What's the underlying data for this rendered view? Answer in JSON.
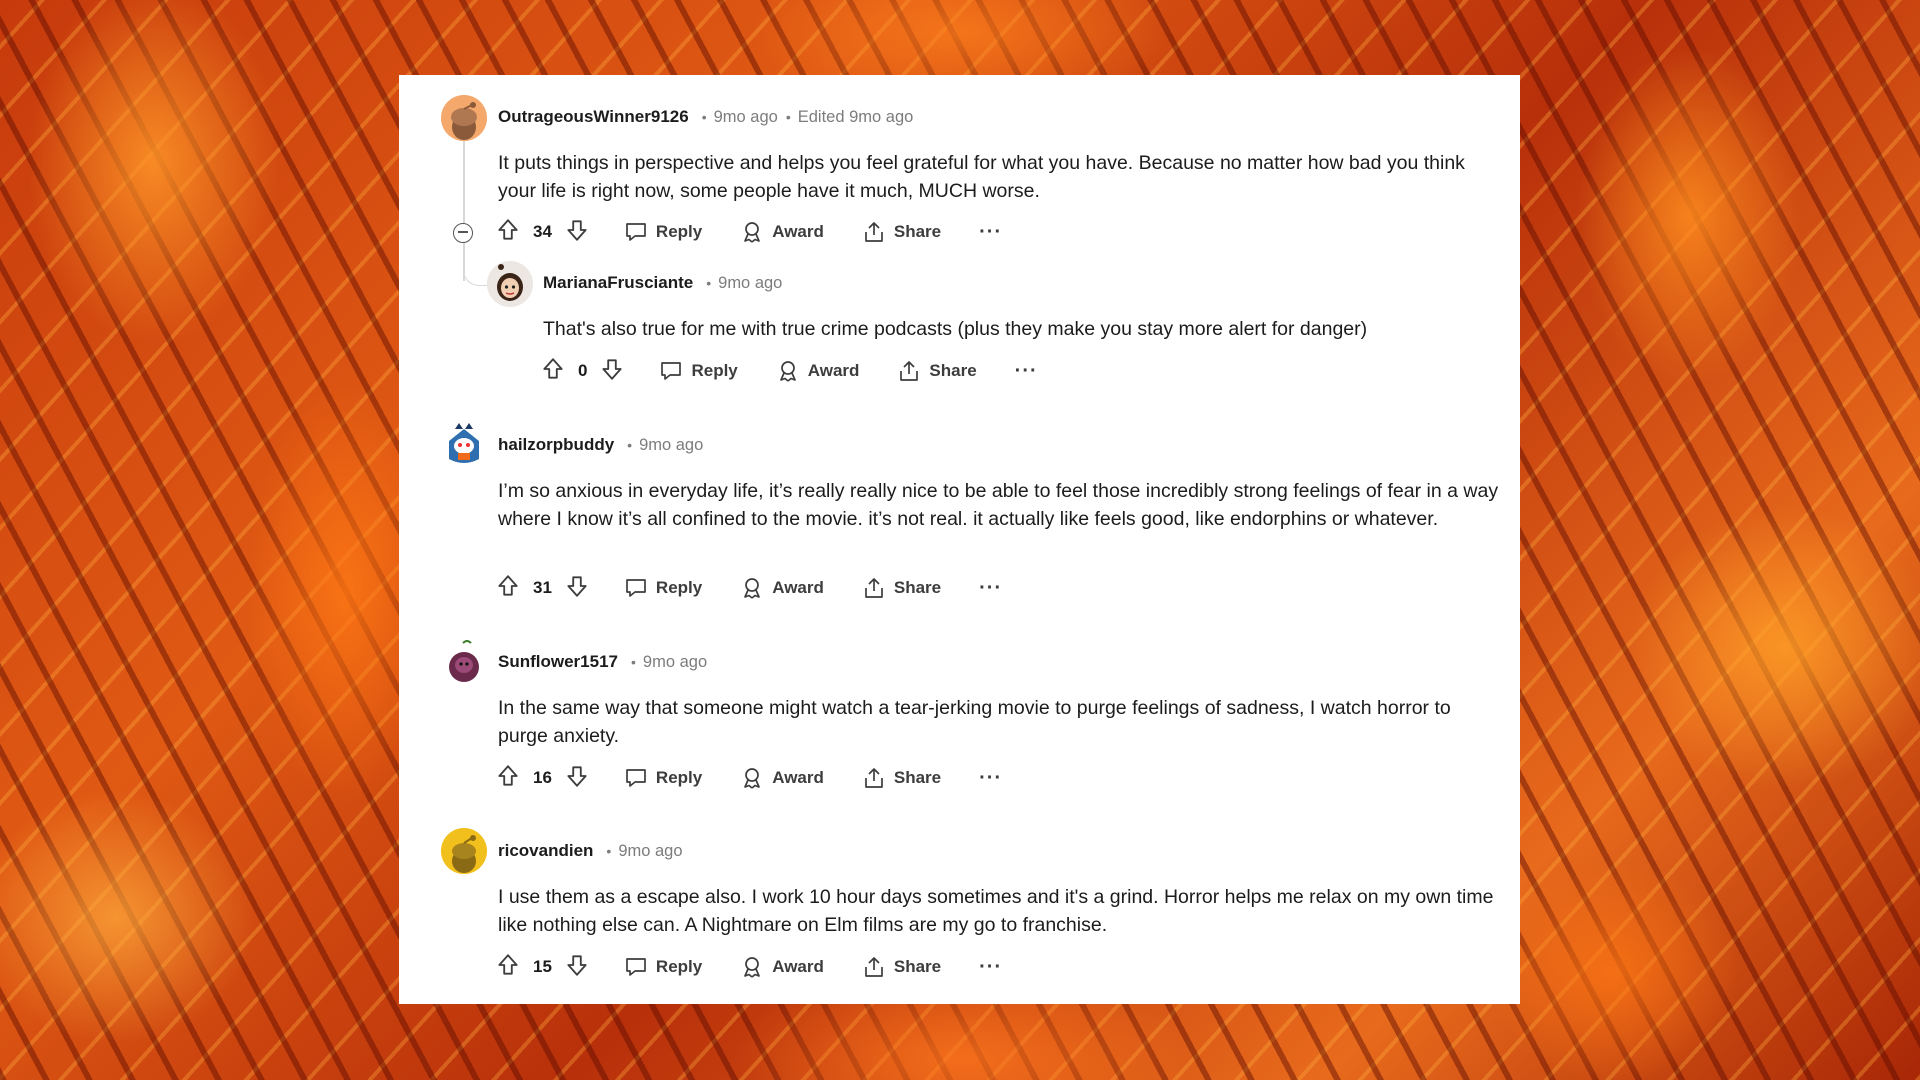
{
  "comments": [
    {
      "username": "OutrageousWinner9126",
      "time": "9mo ago",
      "edited": "Edited 9mo ago",
      "text": "It puts things in perspective and helps you feel grateful for what you have. Because no matter how bad you think your life is right now, some people have it much, MUCH worse.",
      "score": "34",
      "avatar_color": "#f4a86c"
    },
    {
      "username": "MarianaFrusciante",
      "time": "9mo ago",
      "text": "That's also true for me with true crime podcasts (plus they make you stay more alert for danger)",
      "score": "0",
      "avatar_color": "#e9e4df"
    },
    {
      "username": "hailzorpbuddy",
      "time": "9mo ago",
      "text": "I’m so anxious in everyday life, it’s really really nice to be able to feel those incredibly strong feelings of fear in a way where I know it’s all confined to the movie. it’s not real. it actually like feels good, like endorphins or whatever.",
      "score": "31",
      "avatar_color": "#2f6fb0"
    },
    {
      "username": "Sunflower1517",
      "time": "9mo ago",
      "text": "In the same way that someone might watch a tear-jerking movie to purge feelings of sadness, I watch horror to purge anxiety.",
      "score": "16",
      "avatar_color": "#6b2a4c"
    },
    {
      "username": "ricovandien",
      "time": "9mo ago",
      "text": "I use them as a escape also. I work 10 hour days sometimes and it's a grind. Horror helps me relax on my own time like nothing else can. A Nightmare on Elm films are my go to franchise.",
      "score": "15",
      "avatar_color": "#f2c01c"
    }
  ],
  "actions": {
    "reply": "Reply",
    "award": "Award",
    "share": "Share",
    "more": "···"
  },
  "icons": {
    "upvote": "arrow-up-outline",
    "downvote": "arrow-down-outline",
    "reply": "speech-bubble",
    "award": "ribbon-award",
    "share": "share-up-arrow",
    "collapse": "minus-circle"
  }
}
